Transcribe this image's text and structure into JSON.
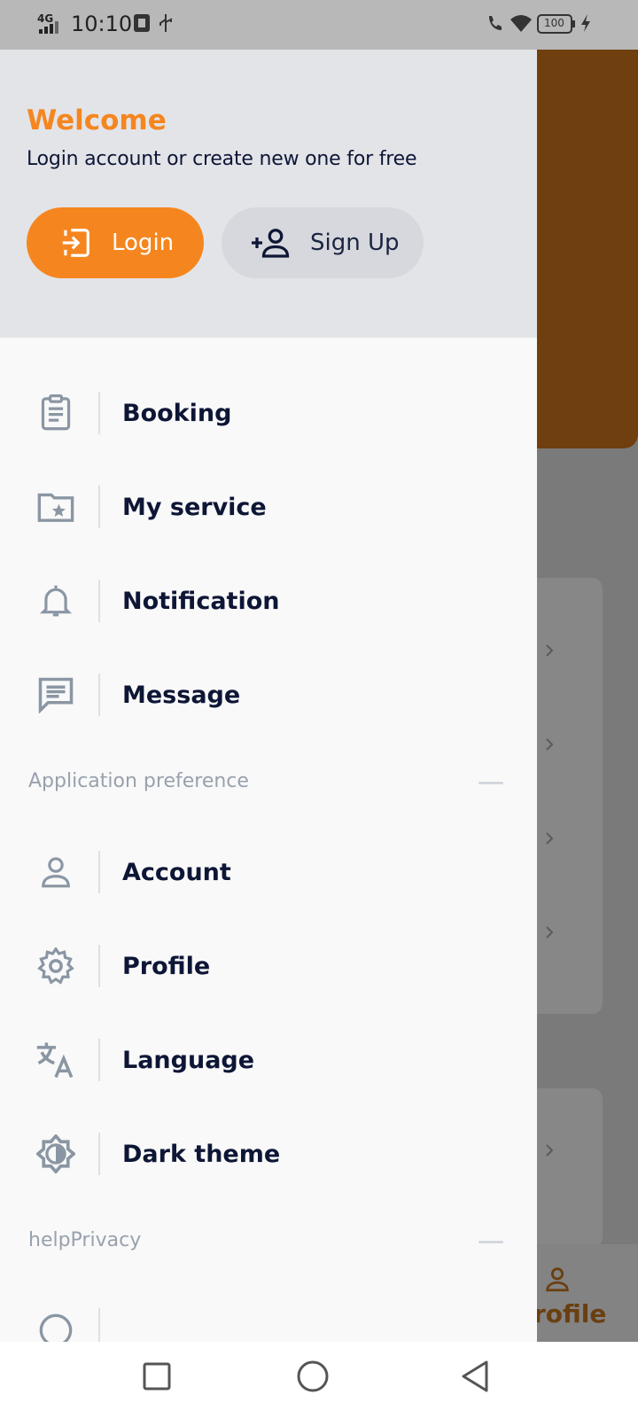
{
  "status_bar": {
    "network": "4G",
    "time": "10:10",
    "battery": "100"
  },
  "drawer": {
    "header": {
      "title": "Welcome",
      "subtitle": "Login account or create new one for free",
      "login_label": "Login",
      "signup_label": "Sign Up"
    },
    "main_items": [
      {
        "label": "Booking",
        "icon": "clipboard-icon"
      },
      {
        "label": "My service",
        "icon": "folder-star-icon"
      },
      {
        "label": "Notification",
        "icon": "bell-icon"
      },
      {
        "label": "Message",
        "icon": "message-icon"
      }
    ],
    "section_app": "Application preference",
    "pref_items": [
      {
        "label": "Account",
        "icon": "person-icon"
      },
      {
        "label": "Profile",
        "icon": "gear-icon"
      },
      {
        "label": "Language",
        "icon": "translate-icon"
      },
      {
        "label": "Dark theme",
        "icon": "brightness-icon"
      }
    ],
    "section_help": "helpPrivacy"
  },
  "background": {
    "nav_label": "rofile"
  },
  "colors": {
    "accent": "#f5861f",
    "text_dark": "#0e1636",
    "icon_gray": "#8a96a3"
  }
}
